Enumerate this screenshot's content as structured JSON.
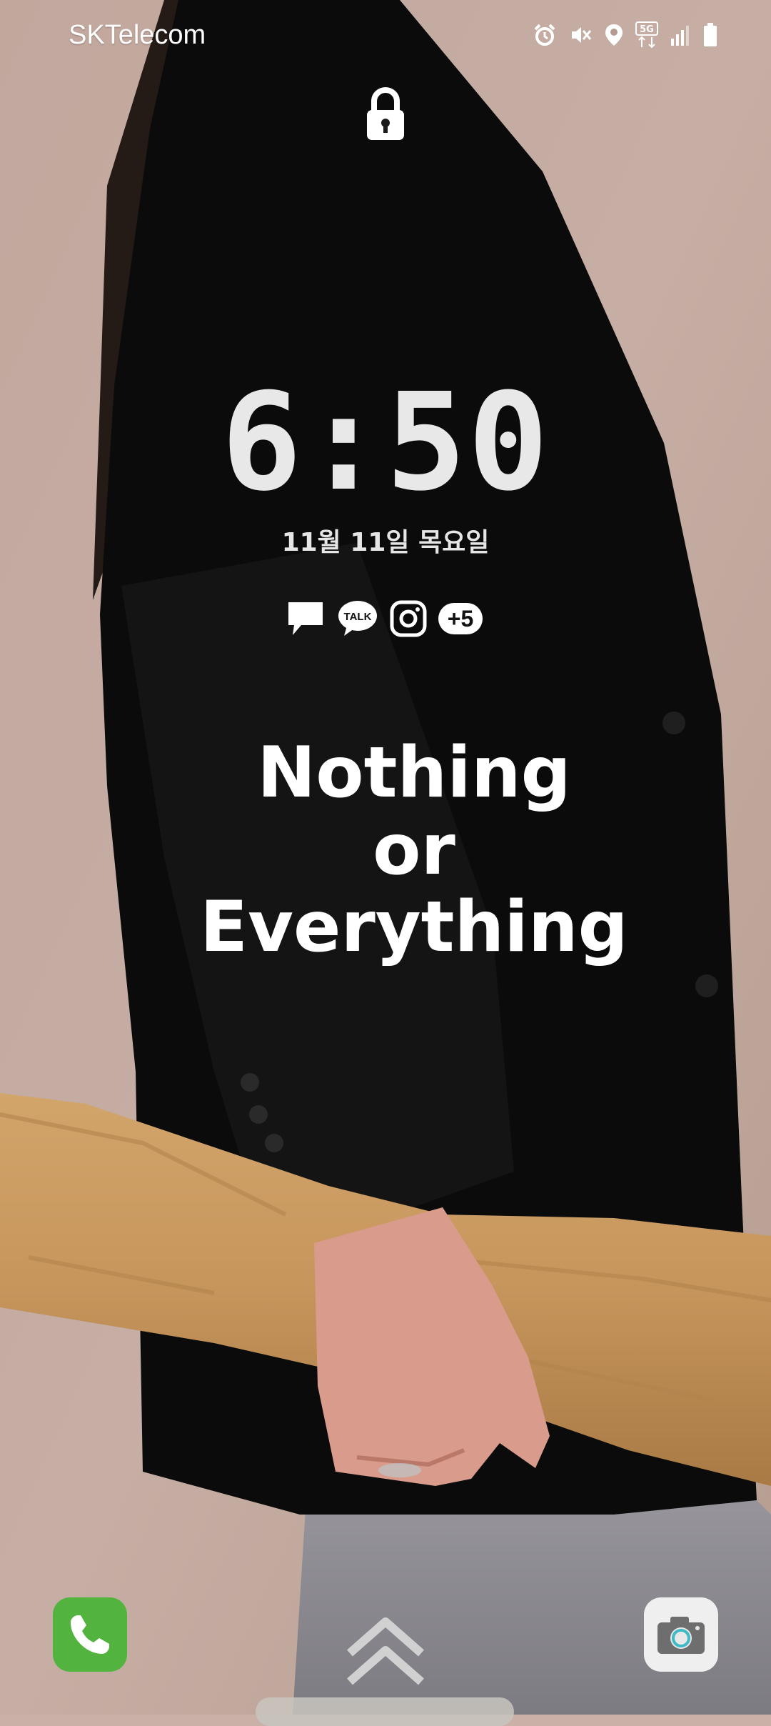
{
  "status_bar": {
    "carrier": "SKTelecom",
    "network": "5G",
    "icons": [
      "alarm-icon",
      "mute-icon",
      "location-icon",
      "5g-data-icon",
      "signal-icon",
      "battery-icon"
    ]
  },
  "lock_screen": {
    "time": "6:50",
    "date": "11월 11일 목요일"
  },
  "notifications": {
    "icons": [
      "message-icon",
      "kakaotalk-icon",
      "instagram-icon"
    ],
    "talk_label": "TALK",
    "more_count": "+5"
  },
  "wallpaper_text": {
    "line1": "Nothing",
    "line2": "or",
    "line3": "Everything"
  },
  "shortcuts": {
    "left": "phone-icon",
    "right": "camera-icon"
  },
  "colors": {
    "phone_green": "#52b43f",
    "camera_bg": "#efefef",
    "clock_text": "#e8e8e8"
  }
}
